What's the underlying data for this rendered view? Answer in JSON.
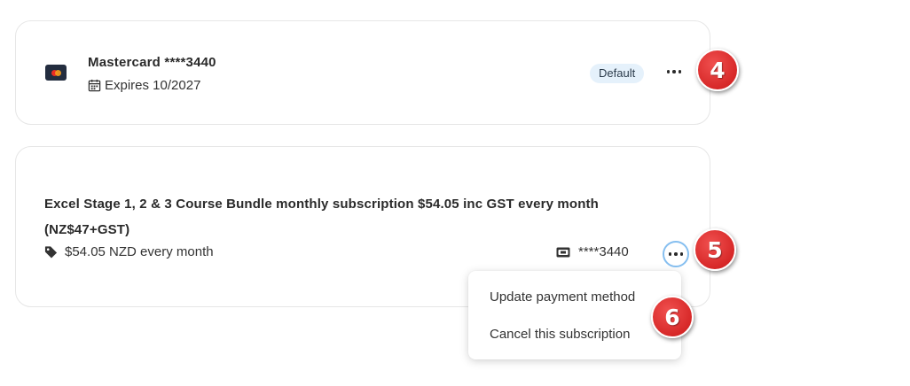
{
  "payment_method": {
    "title": "Mastercard ****3440",
    "expiry": "Expires 10/2027",
    "badge": "Default",
    "logo_icon": "mastercard-logo",
    "expiry_icon": "calendar-icon",
    "more_icon": "more-horizontal-icon"
  },
  "subscription": {
    "title": "Excel Stage 1, 2 & 3 Course Bundle monthly subscription $54.05 inc GST every month (NZ$47+GST)",
    "price": "$54.05 NZD every month",
    "card": "****3440",
    "price_icon": "tag-icon",
    "card_icon": "credit-card-icon",
    "more_icon": "more-horizontal-icon"
  },
  "menu": {
    "items": [
      {
        "label": "Update payment method"
      },
      {
        "label": "Cancel this subscription"
      }
    ]
  },
  "annotations": [
    {
      "label": "4"
    },
    {
      "label": "5"
    },
    {
      "label": "6"
    }
  ],
  "colors": {
    "badge_bg": "#e5f1fb",
    "focus_ring": "#86bff0",
    "step_marker": "#d72828"
  }
}
